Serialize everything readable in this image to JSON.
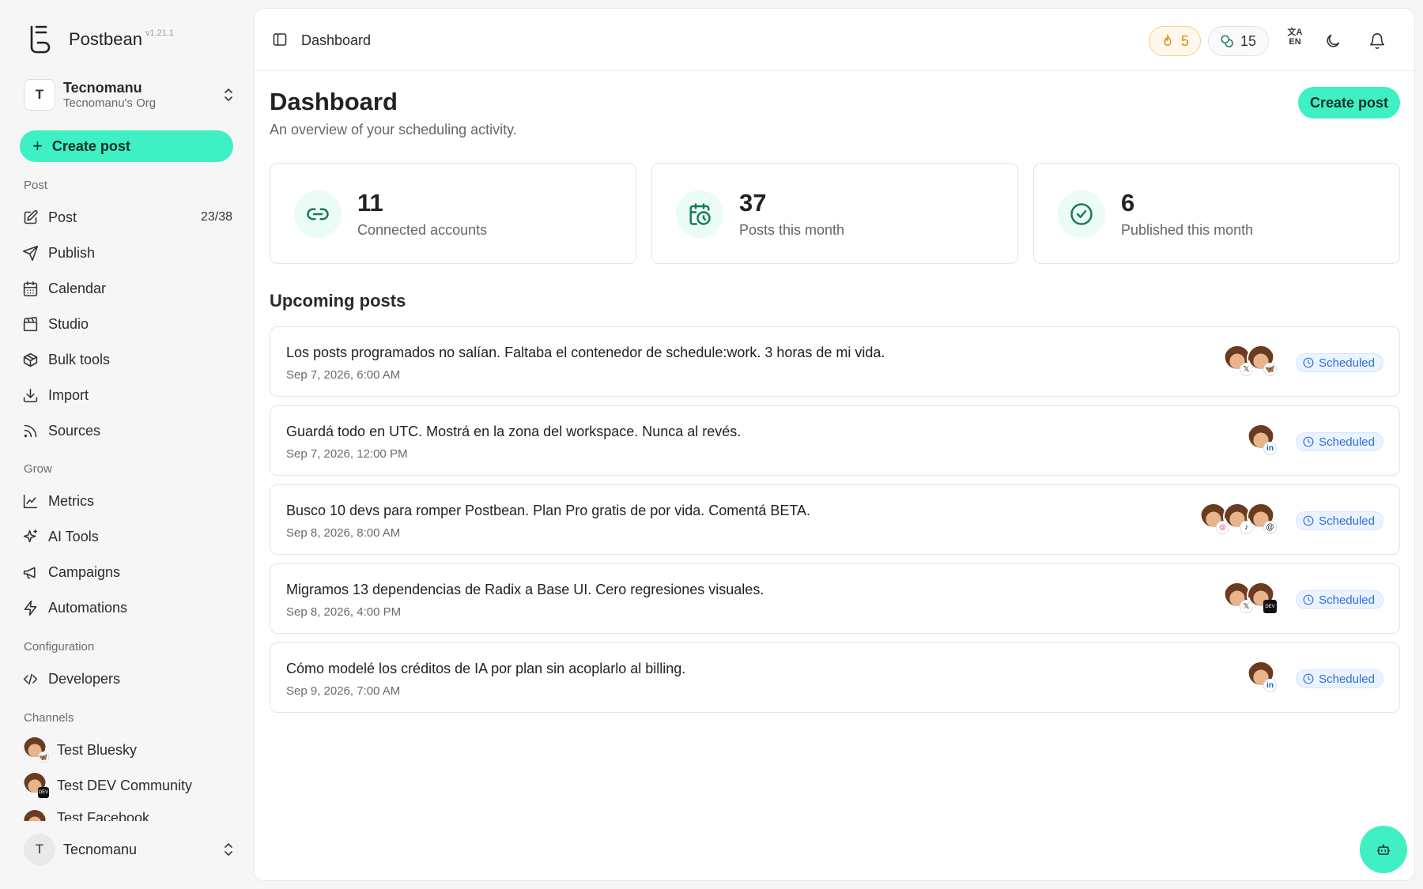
{
  "brand": {
    "name": "Postbean",
    "version": "v1.21.1"
  },
  "org": {
    "initial": "T",
    "name": "Tecnomanu",
    "subtitle": "Tecnomanu's Org"
  },
  "sidebar": {
    "create_label": "Create post",
    "sections": {
      "post": "Post",
      "grow": "Grow",
      "config": "Configuration",
      "channels": "Channels"
    },
    "items": {
      "post": {
        "label": "Post",
        "count": "23/38"
      },
      "publish": {
        "label": "Publish"
      },
      "calendar": {
        "label": "Calendar"
      },
      "studio": {
        "label": "Studio"
      },
      "bulk": {
        "label": "Bulk tools"
      },
      "import": {
        "label": "Import"
      },
      "sources": {
        "label": "Sources"
      },
      "metrics": {
        "label": "Metrics"
      },
      "ai": {
        "label": "AI Tools"
      },
      "campaigns": {
        "label": "Campaigns"
      },
      "automations": {
        "label": "Automations"
      },
      "developers": {
        "label": "Developers"
      }
    },
    "channels": [
      {
        "name": "Test Bluesky"
      },
      {
        "name": "Test DEV Community"
      },
      {
        "name": "Test Facebook"
      }
    ],
    "user": {
      "initial": "T",
      "name": "Tecnomanu"
    }
  },
  "header": {
    "breadcrumb": "Dashboard",
    "streak": "5",
    "credits": "15",
    "language": "EN"
  },
  "page": {
    "title": "Dashboard",
    "subtitle": "An overview of your scheduling activity.",
    "create_label": "Create post"
  },
  "stats": {
    "accounts": {
      "value": "11",
      "label": "Connected accounts"
    },
    "posts": {
      "value": "37",
      "label": "Posts this month"
    },
    "published": {
      "value": "6",
      "label": "Published this month"
    }
  },
  "upcoming": {
    "title": "Upcoming posts",
    "status_label": "Scheduled",
    "posts": [
      {
        "text": "Los posts programados no salían. Faltaba el contenedor de schedule:work. 3 horas de mi vida.",
        "date": "Sep 7, 2026, 6:00 AM",
        "networks": [
          "x-icon",
          "bluesky-icon"
        ]
      },
      {
        "text": "Guardá todo en UTC. Mostrá en la zona del workspace. Nunca al revés.",
        "date": "Sep 7, 2026, 12:00 PM",
        "networks": [
          "linkedin-icon"
        ]
      },
      {
        "text": "Busco 10 devs para romper Postbean. Plan Pro gratis de por vida. Comentá BETA.",
        "date": "Sep 8, 2026, 8:00 AM",
        "networks": [
          "instagram-icon",
          "tiktok-icon",
          "threads-icon"
        ]
      },
      {
        "text": "Migramos 13 dependencias de Radix a Base UI. Cero regresiones visuales.",
        "date": "Sep 8, 2026, 4:00 PM",
        "networks": [
          "x-icon",
          "dev-icon"
        ]
      },
      {
        "text": "Cómo modelé los créditos de IA por plan sin acoplarlo al billing.",
        "date": "Sep 9, 2026, 7:00 AM",
        "networks": [
          "linkedin-icon"
        ]
      }
    ]
  },
  "colors": {
    "accent": "#3ef0c3",
    "scheduled": "#2f6fd6",
    "streak": "#e8860f"
  }
}
